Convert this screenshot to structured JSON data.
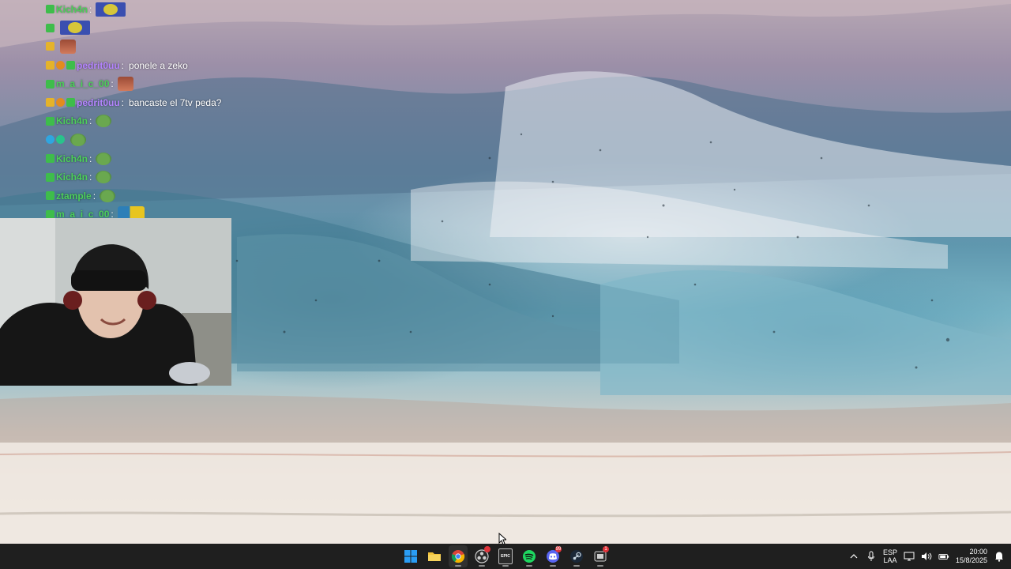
{
  "chat": {
    "messages": [
      {
        "user": "Kich4n",
        "text": "",
        "badges": [
          "green"
        ],
        "user_color": "#4cd05a",
        "emote": "pepe-box"
      },
      {
        "user": "",
        "text": "",
        "badges": [
          "green"
        ],
        "user_color": "#b484ff",
        "emote": "pepe-box"
      },
      {
        "user": "",
        "text": "",
        "badges": [
          "crown"
        ],
        "user_color": "#e0343b",
        "emote": "face"
      },
      {
        "user": "pedrit0uu",
        "text": "ponele a zeko",
        "badges": [
          "crown",
          "mod",
          "green"
        ],
        "user_color": "#b484ff",
        "emote": ""
      },
      {
        "user": "m_a_i_c_00",
        "text": "",
        "badges": [
          "green"
        ],
        "user_color": "#4cd05a",
        "emote": "face"
      },
      {
        "user": "pedrit0uu",
        "text": "bancaste el 7tv peda?",
        "badges": [
          "crown",
          "mod",
          "green"
        ],
        "user_color": "#b484ff",
        "emote": ""
      },
      {
        "user": "Kich4n",
        "text": "",
        "badges": [
          "green"
        ],
        "user_color": "#4cd05a",
        "emote": "pepe"
      },
      {
        "user": "",
        "text": "",
        "badges": [
          "blue",
          "teal"
        ],
        "user_color": "#e0343b",
        "emote": "pepe"
      },
      {
        "user": "Kich4n",
        "text": "",
        "badges": [
          "green"
        ],
        "user_color": "#4cd05a",
        "emote": "pepe"
      },
      {
        "user": "Kich4n",
        "text": "",
        "badges": [
          "green"
        ],
        "user_color": "#4cd05a",
        "emote": "pepe"
      },
      {
        "user": "ztample",
        "text": "",
        "badges": [
          "green"
        ],
        "user_color": "#4cd05a",
        "emote": "pepe"
      },
      {
        "user": "m_a_i_c_00",
        "text": "",
        "badges": [
          "green"
        ],
        "user_color": "#4cd05a",
        "emote": "multi"
      }
    ]
  },
  "taskbar": {
    "apps": [
      {
        "name": "start",
        "icon": "windows-icon",
        "active": false,
        "notif": ""
      },
      {
        "name": "file-explorer",
        "icon": "folder-icon",
        "active": false,
        "notif": ""
      },
      {
        "name": "chrome",
        "icon": "chrome-icon",
        "active": true,
        "notif": ""
      },
      {
        "name": "obs",
        "icon": "obs-icon",
        "active": false,
        "notif": ""
      },
      {
        "name": "epic-games",
        "icon": "epic-games-icon",
        "active": false,
        "notif": ""
      },
      {
        "name": "spotify",
        "icon": "spotify-icon",
        "active": false,
        "notif": ""
      },
      {
        "name": "discord",
        "icon": "discord-icon",
        "active": false,
        "notif": "99"
      },
      {
        "name": "steam",
        "icon": "steam-icon",
        "active": false,
        "notif": ""
      },
      {
        "name": "overlay-app",
        "icon": "overlay-app-icon",
        "active": false,
        "notif": "1"
      }
    ],
    "epic_label": "EPIC",
    "language_top": "ESP",
    "language_bottom": "LAA",
    "time": "20:00",
    "date": "15/8/2025"
  },
  "colors": {
    "taskbar_bg": "#1f1f1f",
    "notif_red": "#e0343b",
    "spotify_green": "#1ed760",
    "discord_blurple": "#5865f2",
    "windows_blue": "#2a9df4"
  }
}
